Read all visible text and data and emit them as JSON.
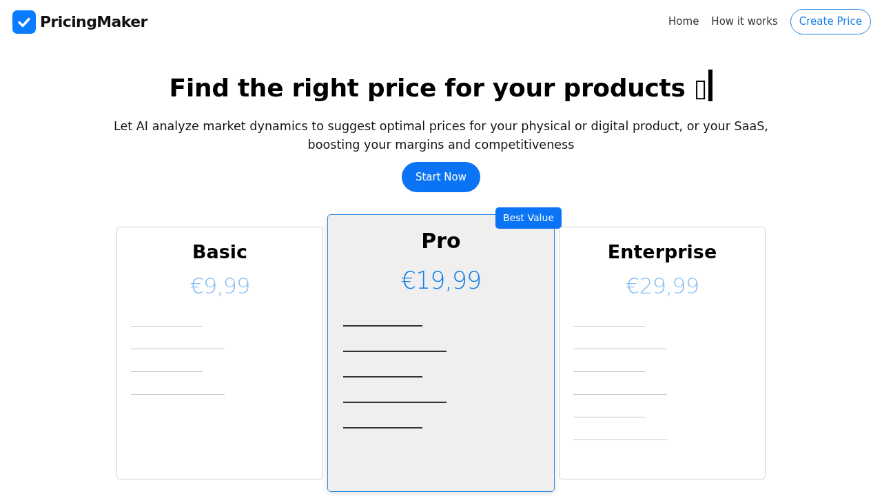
{
  "navbar": {
    "brand": "PricingMaker",
    "links": [
      "Home",
      "How it works"
    ],
    "cta": "Create Price"
  },
  "hero": {
    "title": "Find the right price for your products ▯",
    "cursor": true,
    "subtitle": "Let AI analyze market dynamics to suggest optimal prices for your physical or digital product, or your SaaS, boosting your margins and competitiveness",
    "button": "Start Now"
  },
  "plans": [
    {
      "name": "Basic",
      "price": "€9,99",
      "featured": false,
      "feature_lines": [
        {
          "kind": "short"
        },
        {
          "kind": "long"
        },
        {
          "kind": "short"
        },
        {
          "kind": "long"
        }
      ]
    },
    {
      "name": "Pro",
      "price": "€19,99",
      "featured": true,
      "badge": "Best Value",
      "feature_lines": [
        {
          "kind": "short"
        },
        {
          "kind": "long"
        },
        {
          "kind": "short"
        },
        {
          "kind": "long"
        },
        {
          "kind": "short"
        }
      ]
    },
    {
      "name": "Enterprise",
      "price": "€29,99",
      "featured": false,
      "feature_lines": [
        {
          "kind": "short"
        },
        {
          "kind": "long"
        },
        {
          "kind": "short"
        },
        {
          "kind": "long"
        },
        {
          "kind": "short"
        },
        {
          "kind": "long"
        }
      ]
    }
  ]
}
